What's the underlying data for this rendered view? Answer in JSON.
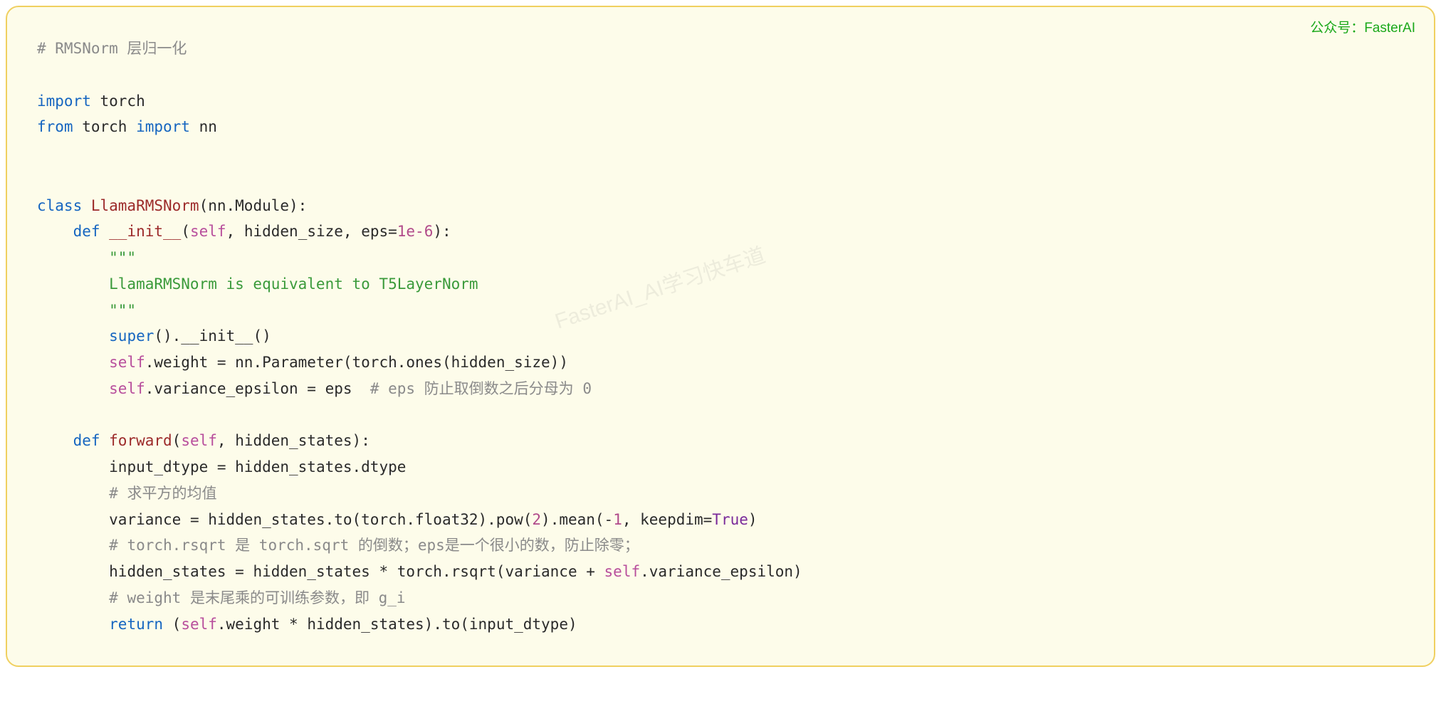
{
  "attribution": "公众号：FasterAI",
  "watermark": "FasterAI_AI学习快车道",
  "code": {
    "l01": "# RMSNorm 层归一化",
    "l02_import": "import",
    "l02_torch": " torch",
    "l03_from": "from",
    "l03_torch": " torch ",
    "l03_import": "import",
    "l03_nn": " nn",
    "l04_class": "class",
    "l04_name": " LlamaRMSNorm",
    "l04_rest": "(nn.Module):",
    "l05_def": "def",
    "l05_name": " __init__",
    "l05_open": "(",
    "l05_self": "self",
    "l05_args": ", hidden_size, eps=",
    "l05_num": "1e-6",
    "l05_close": "):",
    "l06_a": "        \"\"\"",
    "l06_b": "        LlamaRMSNorm is equivalent to T5LayerNorm",
    "l06_c": "        \"\"\"",
    "l07_super": "super",
    "l07_rest": "().__init__()",
    "l08_self": "self",
    "l08_rest": ".weight = nn.Parameter(torch.ones(hidden_size))",
    "l09_self": "self",
    "l09_rest": ".variance_epsilon = eps  ",
    "l09_comment": "# eps 防止取倒数之后分母为 0",
    "l10_def": "def",
    "l10_name": " forward",
    "l10_open": "(",
    "l10_self": "self",
    "l10_rest": ", hidden_states):",
    "l11": "input_dtype = hidden_states.dtype",
    "l12_comment": "# 求平方的均值",
    "l13_a": "variance = hidden_states.to(torch.float32).pow(",
    "l13_two": "2",
    "l13_b": ").mean(-",
    "l13_one": "1",
    "l13_c": ", keepdim=",
    "l13_true": "True",
    "l13_d": ")",
    "l14_comment": "# torch.rsqrt 是 torch.sqrt 的倒数；eps是一个很小的数，防止除零；",
    "l15_a": "hidden_states = hidden_states * torch.rsqrt(variance + ",
    "l15_self": "self",
    "l15_b": ".variance_epsilon)",
    "l16_comment": "# weight 是末尾乘的可训练参数，即 g_i",
    "l17_return": "return",
    "l17_a": " (",
    "l17_self": "self",
    "l17_b": ".weight * hidden_states).to(input_dtype)"
  }
}
